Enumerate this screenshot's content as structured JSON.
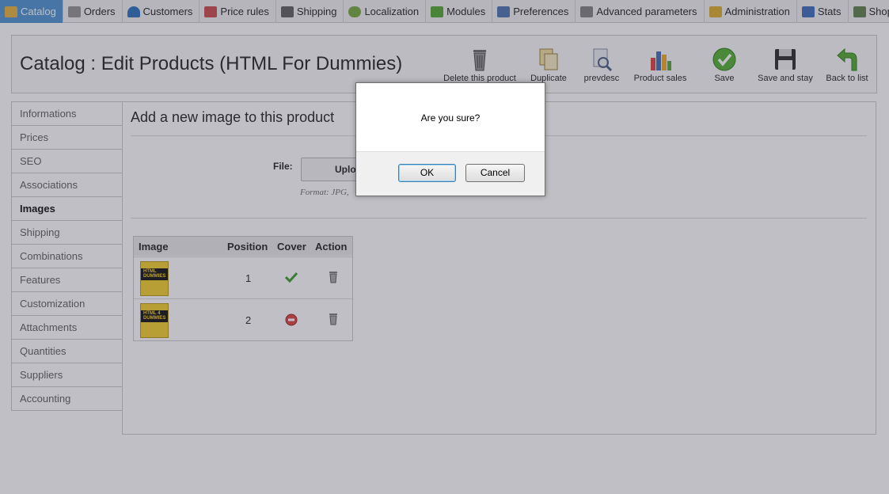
{
  "topnav": {
    "tabs": [
      {
        "label": "Catalog",
        "icon": "folder-icon",
        "color": "#e8b84a"
      },
      {
        "label": "Orders",
        "icon": "cart-icon",
        "color": "#8a8a8a"
      },
      {
        "label": "Customers",
        "icon": "user-icon",
        "color": "#3b7bbf"
      },
      {
        "label": "Price rules",
        "icon": "price-tag-icon",
        "color": "#d05a5a"
      },
      {
        "label": "Shipping",
        "icon": "truck-icon",
        "color": "#6a6a6a"
      },
      {
        "label": "Localization",
        "icon": "globe-icon",
        "color": "#7fb04a"
      },
      {
        "label": "Modules",
        "icon": "puzzle-icon",
        "color": "#5fae3f"
      },
      {
        "label": "Preferences",
        "icon": "preferences-icon",
        "color": "#5a7fb5"
      },
      {
        "label": "Advanced parameters",
        "icon": "wrench-icon",
        "color": "#8a8a8a"
      },
      {
        "label": "Administration",
        "icon": "key-icon",
        "color": "#e0b23a"
      },
      {
        "label": "Stats",
        "icon": "bar-chart-icon",
        "color": "#4a78c0"
      },
      {
        "label": "Shops",
        "icon": "shop-icon",
        "color": "#6a8a5a"
      }
    ]
  },
  "header": {
    "title": "Catalog : Edit Products (HTML For Dummies)",
    "tools": [
      {
        "label": "Delete this product",
        "icon": "trash-icon"
      },
      {
        "label": "Duplicate",
        "icon": "duplicate-icon"
      },
      {
        "label": "prevdesc",
        "icon": "preview-icon"
      },
      {
        "label": "Product sales",
        "icon": "bar-chart-icon"
      },
      {
        "label": "Save",
        "icon": "checkmark-icon"
      },
      {
        "label": "Save and stay",
        "icon": "floppy-icon"
      },
      {
        "label": "Back to list",
        "icon": "back-arrow-icon"
      }
    ]
  },
  "sidebar": {
    "items": [
      "Informations",
      "Prices",
      "SEO",
      "Associations",
      "Images",
      "Shipping",
      "Combinations",
      "Features",
      "Customization",
      "Attachments",
      "Quantities",
      "Suppliers",
      "Accounting"
    ],
    "active": "Images"
  },
  "main": {
    "heading": "Add a new image to this product",
    "file_label": "File:",
    "upload_label": "Uploa",
    "format_text": "Format: JPG,",
    "table": {
      "headers": [
        "Image",
        "Position",
        "Cover",
        "Action"
      ],
      "rows": [
        {
          "position": "1",
          "cover": "checkmark-icon",
          "cover_title": "HTML DUMMIES"
        },
        {
          "position": "2",
          "cover": "no-entry-icon",
          "cover_title": "HTML 4 DUMMIES"
        }
      ]
    }
  },
  "dialog": {
    "message": "Are you sure?",
    "ok_label": "OK",
    "cancel_label": "Cancel"
  }
}
